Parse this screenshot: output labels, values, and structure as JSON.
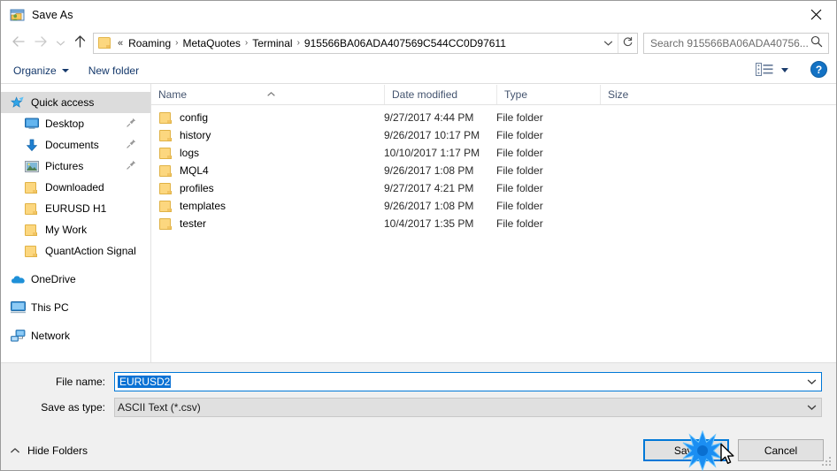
{
  "window": {
    "title": "Save As",
    "title_icon": "save-as-folder-person-icon",
    "close_icon": "close-icon"
  },
  "nav": {
    "back_icon": "arrow-left-icon",
    "forward_icon": "arrow-right-icon",
    "recent_icon": "chevron-down-icon",
    "up_icon": "arrow-up-icon",
    "address_folder_icon": "folder-icon",
    "overflow": "«",
    "breadcrumbs": [
      "Roaming",
      "MetaQuotes",
      "Terminal",
      "915566BA06ADA407569C544CC0D97611"
    ],
    "separator": "›",
    "dropdown_icon": "chevron-down-icon",
    "refresh_icon": "refresh-icon",
    "search": {
      "placeholder": "Search 915566BA06ADA40756...",
      "icon": "search-icon"
    }
  },
  "command_bar": {
    "organize_label": "Organize",
    "organize_caret_icon": "caret-down-icon",
    "new_folder_label": "New folder",
    "view_icon": "view-list-icon",
    "view_caret_icon": "caret-down-icon",
    "help_icon": "help-question-icon"
  },
  "sidebar": {
    "items": [
      {
        "label": "Quick access",
        "icon": "star-pin-icon",
        "indent": false,
        "selected": true,
        "pinned": false,
        "group": false
      },
      {
        "label": "Desktop",
        "icon": "desktop-icon",
        "indent": true,
        "selected": false,
        "pinned": true,
        "group": false
      },
      {
        "label": "Documents",
        "icon": "documents-down-arrow-icon",
        "indent": true,
        "selected": false,
        "pinned": true,
        "group": false
      },
      {
        "label": "Pictures",
        "icon": "pictures-icon",
        "indent": true,
        "selected": false,
        "pinned": true,
        "group": false
      },
      {
        "label": "Downloaded",
        "icon": "folder-icon",
        "indent": true,
        "selected": false,
        "pinned": false,
        "group": false
      },
      {
        "label": "EURUSD H1",
        "icon": "folder-icon",
        "indent": true,
        "selected": false,
        "pinned": false,
        "group": false
      },
      {
        "label": "My Work",
        "icon": "folder-icon",
        "indent": true,
        "selected": false,
        "pinned": false,
        "group": false
      },
      {
        "label": "QuantAction Signal",
        "icon": "folder-icon",
        "indent": true,
        "selected": false,
        "pinned": false,
        "group": false
      },
      {
        "label": "OneDrive",
        "icon": "onedrive-cloud-icon",
        "indent": false,
        "selected": false,
        "pinned": false,
        "group": true
      },
      {
        "label": "This PC",
        "icon": "this-pc-monitor-icon",
        "indent": false,
        "selected": false,
        "pinned": false,
        "group": true
      },
      {
        "label": "Network",
        "icon": "network-icon",
        "indent": false,
        "selected": false,
        "pinned": false,
        "group": true
      }
    ]
  },
  "file_list": {
    "columns": [
      "Name",
      "Date modified",
      "Type",
      "Size"
    ],
    "sort_column": "Name",
    "sort_direction": "ascending",
    "sort_icon": "caret-up-icon",
    "rows": [
      {
        "name": "config",
        "icon": "folder-icon",
        "date_modified": "9/27/2017 4:44 PM",
        "type": "File folder",
        "size": ""
      },
      {
        "name": "history",
        "icon": "folder-icon",
        "date_modified": "9/26/2017 10:17 PM",
        "type": "File folder",
        "size": ""
      },
      {
        "name": "logs",
        "icon": "folder-icon",
        "date_modified": "10/10/2017 1:17 PM",
        "type": "File folder",
        "size": ""
      },
      {
        "name": "MQL4",
        "icon": "folder-icon",
        "date_modified": "9/26/2017 1:08 PM",
        "type": "File folder",
        "size": ""
      },
      {
        "name": "profiles",
        "icon": "folder-icon",
        "date_modified": "9/27/2017 4:21 PM",
        "type": "File folder",
        "size": ""
      },
      {
        "name": "templates",
        "icon": "folder-icon",
        "date_modified": "9/26/2017 1:08 PM",
        "type": "File folder",
        "size": ""
      },
      {
        "name": "tester",
        "icon": "folder-icon",
        "date_modified": "10/4/2017 1:35 PM",
        "type": "File folder",
        "size": ""
      }
    ]
  },
  "form": {
    "file_name_label": "File name:",
    "file_name_value": "EURUSD2",
    "file_name_selected": true,
    "save_as_type_label": "Save as type:",
    "save_as_type_value": "ASCII Text (*.csv)",
    "dropdown_icon": "chevron-down-icon"
  },
  "footer": {
    "hide_folders_label": "Hide Folders",
    "hide_folders_icon": "chevron-up-icon",
    "save_label": "Save",
    "cancel_label": "Cancel",
    "resize_grip_icon": "resize-grip-icon"
  },
  "pointer": {
    "cursor_icon": "mouse-cursor-icon",
    "click_effect_icon": "click-burst-icon"
  },
  "colors": {
    "accent": "#0078d7",
    "selection": "#0b72d4",
    "folder": "#fcd77f",
    "chrome": "#f0f0f0",
    "link_text": "#14386b"
  }
}
